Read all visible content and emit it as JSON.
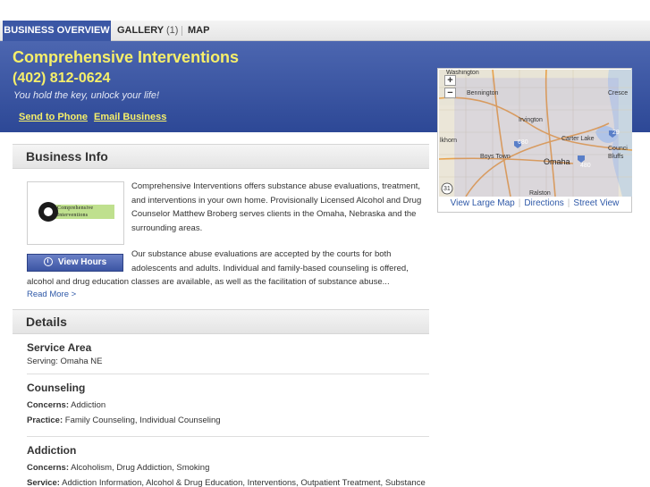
{
  "tabs": [
    {
      "label": "BUSINESS OVERVIEW"
    },
    {
      "label": "GALLERY",
      "count": "(1)"
    },
    {
      "label": "MAP"
    }
  ],
  "business": {
    "name": "Comprehensive Interventions",
    "phone": "(402) 812-0624",
    "tagline": "You hold the key, unlock your life!",
    "send_to_phone": "Send to Phone",
    "email_business": "Email Business"
  },
  "map": {
    "labels": {
      "washington": "Washington",
      "bennington": "Bennington",
      "irvington": "Irvington",
      "crescent": "Cresce",
      "elkhorn": "lkhorn",
      "carter_lake": "Carter Lake",
      "boys_town": "Boys Town",
      "omaha": "Omaha",
      "council_bluffs": "Counci Bluffs",
      "ralston": "Ralston",
      "hwy_680": "680",
      "hwy_29": "29",
      "hwy_480": "480",
      "hwy_31": "31"
    },
    "links": {
      "large": "View Large Map",
      "directions": "Directions",
      "street": "Street View"
    }
  },
  "business_info": {
    "heading": "Business Info",
    "logo_text_line1": "Comprehensive",
    "logo_text_line2": "Interventions",
    "view_hours": "View Hours",
    "desc_lines": [
      "Comprehensive Interventions offers substance abuse evaluations, treatment,",
      "and interventions in your own home. Provisionally Licensed Alcohol and Drug",
      "Counselor Matthew Broberg serves clients in the Omaha, Nebraska and the",
      "surrounding areas."
    ],
    "desc2_lines": [
      "Our substance abuse evaluations are accepted by the courts for both",
      "adolescents and adults. Individual and family-based counseling is offered,"
    ],
    "desc3_line": "alcohol and drug education classes are available, as well as the facilitation of substance abuse...",
    "read_more": "Read More >"
  },
  "details": {
    "heading": "Details",
    "service_area": {
      "title": "Service Area",
      "text": "Serving: Omaha NE"
    },
    "counseling": {
      "title": "Counseling",
      "concerns_label": "Concerns:",
      "concerns": "Addiction",
      "practice_label": "Practice:",
      "practice": "Family Counseling, Individual Counseling"
    },
    "addiction": {
      "title": "Addiction",
      "concerns_label": "Concerns:",
      "concerns": "Alcoholism, Drug Addiction, Smoking",
      "service_label": "Service:",
      "service": "Addiction Information, Alcohol & Drug Education, Interventions, Outpatient Treatment, Substance"
    }
  },
  "colors": {
    "accent_blue": "#3b57a5",
    "header_yellow": "#f6ef6a",
    "link_blue": "#2f59a8"
  }
}
